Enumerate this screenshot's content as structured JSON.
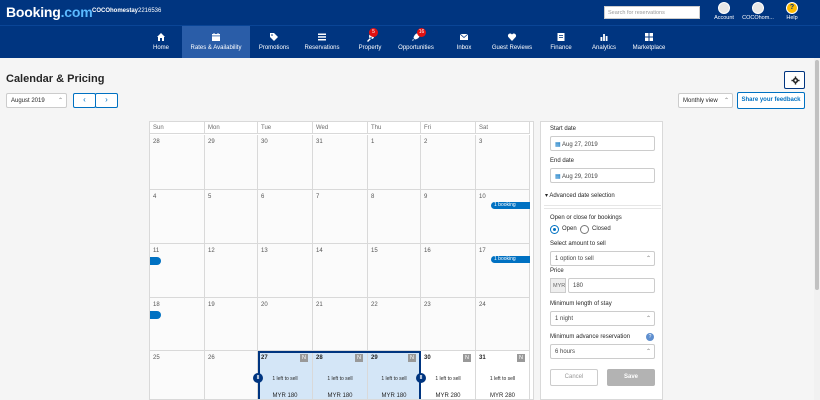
{
  "topbar": {
    "logo_main": "Booking",
    "logo_dot": ".com",
    "property_name": "COCOhomestay",
    "property_id": "2216536",
    "search_placeholder": "Search for reservations",
    "account_label": "Account",
    "property_menu_label": "COCOhom...",
    "help_label": "Help",
    "help_glyph": "?"
  },
  "nav": {
    "items": [
      {
        "label": "Home",
        "icon": "home-icon"
      },
      {
        "label": "Rates & Availability",
        "icon": "calendar-icon",
        "active": true
      },
      {
        "label": "Promotions",
        "icon": "tag-icon"
      },
      {
        "label": "Reservations",
        "icon": "list-icon"
      },
      {
        "label": "Property",
        "icon": "wrench-icon",
        "badge": "5"
      },
      {
        "label": "Opportunities",
        "icon": "rocket-icon",
        "badge": "16"
      },
      {
        "label": "Inbox",
        "icon": "envelope-icon"
      },
      {
        "label": "Guest Reviews",
        "icon": "heart-icon"
      },
      {
        "label": "Finance",
        "icon": "finance-icon"
      },
      {
        "label": "Analytics",
        "icon": "bar-chart-icon"
      },
      {
        "label": "Marketplace",
        "icon": "grid-icon"
      }
    ]
  },
  "header": {
    "title": "Calendar & Pricing",
    "month": "August 2019",
    "prev": "‹",
    "next": "›",
    "view": "Monthly view",
    "feedback": "Share your feedback",
    "chevron": "⌃"
  },
  "calendar": {
    "days": [
      "Sun",
      "Mon",
      "Tue",
      "Wed",
      "Thu",
      "Fri",
      "Sat"
    ],
    "weeks": [
      [
        "28",
        "29",
        "30",
        "31",
        "1",
        "2",
        "3"
      ],
      [
        "4",
        "5",
        "6",
        "7",
        "8",
        "9",
        "10"
      ],
      [
        "11",
        "12",
        "13",
        "14",
        "15",
        "16",
        "17"
      ],
      [
        "18",
        "19",
        "20",
        "21",
        "22",
        "23",
        "24"
      ],
      [
        "25",
        "26",
        "27",
        "28",
        "29",
        "30",
        "31"
      ]
    ],
    "booking_label": "1 booking",
    "n_tag": "N",
    "sell_text": "1 left to sell",
    "price_selected": "MYR 180",
    "price_other": "MYR 280",
    "handle_glyph": "II",
    "accent": "#003580",
    "selected_fill": "#d4e6f7"
  },
  "panel": {
    "start_label": "Start date",
    "start_value": "Aug 27, 2019",
    "end_label": "End date",
    "end_value": "Aug 29, 2019",
    "advanced": "▾ Advanced date selection",
    "open_close_label": "Open or close for bookings",
    "open": "Open",
    "closed": "Closed",
    "amount_label": "Select amount to sell",
    "amount_value": "1 option to sell",
    "price_label": "Price",
    "currency": "MYR",
    "price_value": "180",
    "min_stay_label": "Minimum length of stay",
    "min_stay_value": "1 night",
    "min_adv_label": "Minimum advance reservation",
    "min_adv_value": "6 hours",
    "help_glyph": "?",
    "cancel": "Cancel",
    "save": "Save",
    "chevron": "⌃"
  }
}
